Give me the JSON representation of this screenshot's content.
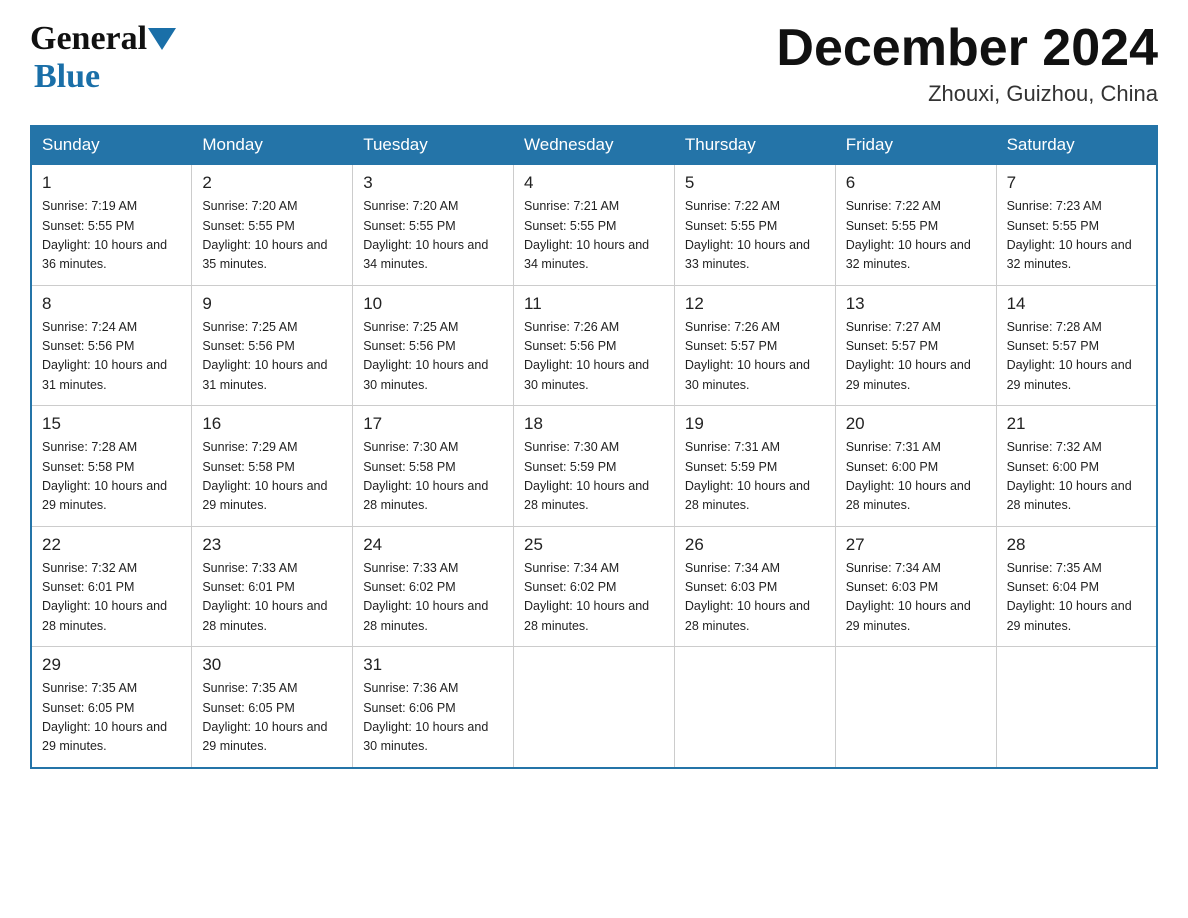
{
  "header": {
    "logo_general": "General",
    "logo_blue": "Blue",
    "month_title": "December 2024",
    "subtitle": "Zhouxi, Guizhou, China"
  },
  "weekdays": [
    "Sunday",
    "Monday",
    "Tuesday",
    "Wednesday",
    "Thursday",
    "Friday",
    "Saturday"
  ],
  "weeks": [
    [
      {
        "day": "1",
        "sunrise": "7:19 AM",
        "sunset": "5:55 PM",
        "daylight": "10 hours and 36 minutes."
      },
      {
        "day": "2",
        "sunrise": "7:20 AM",
        "sunset": "5:55 PM",
        "daylight": "10 hours and 35 minutes."
      },
      {
        "day": "3",
        "sunrise": "7:20 AM",
        "sunset": "5:55 PM",
        "daylight": "10 hours and 34 minutes."
      },
      {
        "day": "4",
        "sunrise": "7:21 AM",
        "sunset": "5:55 PM",
        "daylight": "10 hours and 34 minutes."
      },
      {
        "day": "5",
        "sunrise": "7:22 AM",
        "sunset": "5:55 PM",
        "daylight": "10 hours and 33 minutes."
      },
      {
        "day": "6",
        "sunrise": "7:22 AM",
        "sunset": "5:55 PM",
        "daylight": "10 hours and 32 minutes."
      },
      {
        "day": "7",
        "sunrise": "7:23 AM",
        "sunset": "5:55 PM",
        "daylight": "10 hours and 32 minutes."
      }
    ],
    [
      {
        "day": "8",
        "sunrise": "7:24 AM",
        "sunset": "5:56 PM",
        "daylight": "10 hours and 31 minutes."
      },
      {
        "day": "9",
        "sunrise": "7:25 AM",
        "sunset": "5:56 PM",
        "daylight": "10 hours and 31 minutes."
      },
      {
        "day": "10",
        "sunrise": "7:25 AM",
        "sunset": "5:56 PM",
        "daylight": "10 hours and 30 minutes."
      },
      {
        "day": "11",
        "sunrise": "7:26 AM",
        "sunset": "5:56 PM",
        "daylight": "10 hours and 30 minutes."
      },
      {
        "day": "12",
        "sunrise": "7:26 AM",
        "sunset": "5:57 PM",
        "daylight": "10 hours and 30 minutes."
      },
      {
        "day": "13",
        "sunrise": "7:27 AM",
        "sunset": "5:57 PM",
        "daylight": "10 hours and 29 minutes."
      },
      {
        "day": "14",
        "sunrise": "7:28 AM",
        "sunset": "5:57 PM",
        "daylight": "10 hours and 29 minutes."
      }
    ],
    [
      {
        "day": "15",
        "sunrise": "7:28 AM",
        "sunset": "5:58 PM",
        "daylight": "10 hours and 29 minutes."
      },
      {
        "day": "16",
        "sunrise": "7:29 AM",
        "sunset": "5:58 PM",
        "daylight": "10 hours and 29 minutes."
      },
      {
        "day": "17",
        "sunrise": "7:30 AM",
        "sunset": "5:58 PM",
        "daylight": "10 hours and 28 minutes."
      },
      {
        "day": "18",
        "sunrise": "7:30 AM",
        "sunset": "5:59 PM",
        "daylight": "10 hours and 28 minutes."
      },
      {
        "day": "19",
        "sunrise": "7:31 AM",
        "sunset": "5:59 PM",
        "daylight": "10 hours and 28 minutes."
      },
      {
        "day": "20",
        "sunrise": "7:31 AM",
        "sunset": "6:00 PM",
        "daylight": "10 hours and 28 minutes."
      },
      {
        "day": "21",
        "sunrise": "7:32 AM",
        "sunset": "6:00 PM",
        "daylight": "10 hours and 28 minutes."
      }
    ],
    [
      {
        "day": "22",
        "sunrise": "7:32 AM",
        "sunset": "6:01 PM",
        "daylight": "10 hours and 28 minutes."
      },
      {
        "day": "23",
        "sunrise": "7:33 AM",
        "sunset": "6:01 PM",
        "daylight": "10 hours and 28 minutes."
      },
      {
        "day": "24",
        "sunrise": "7:33 AM",
        "sunset": "6:02 PM",
        "daylight": "10 hours and 28 minutes."
      },
      {
        "day": "25",
        "sunrise": "7:34 AM",
        "sunset": "6:02 PM",
        "daylight": "10 hours and 28 minutes."
      },
      {
        "day": "26",
        "sunrise": "7:34 AM",
        "sunset": "6:03 PM",
        "daylight": "10 hours and 28 minutes."
      },
      {
        "day": "27",
        "sunrise": "7:34 AM",
        "sunset": "6:03 PM",
        "daylight": "10 hours and 29 minutes."
      },
      {
        "day": "28",
        "sunrise": "7:35 AM",
        "sunset": "6:04 PM",
        "daylight": "10 hours and 29 minutes."
      }
    ],
    [
      {
        "day": "29",
        "sunrise": "7:35 AM",
        "sunset": "6:05 PM",
        "daylight": "10 hours and 29 minutes."
      },
      {
        "day": "30",
        "sunrise": "7:35 AM",
        "sunset": "6:05 PM",
        "daylight": "10 hours and 29 minutes."
      },
      {
        "day": "31",
        "sunrise": "7:36 AM",
        "sunset": "6:06 PM",
        "daylight": "10 hours and 30 minutes."
      },
      null,
      null,
      null,
      null
    ]
  ]
}
